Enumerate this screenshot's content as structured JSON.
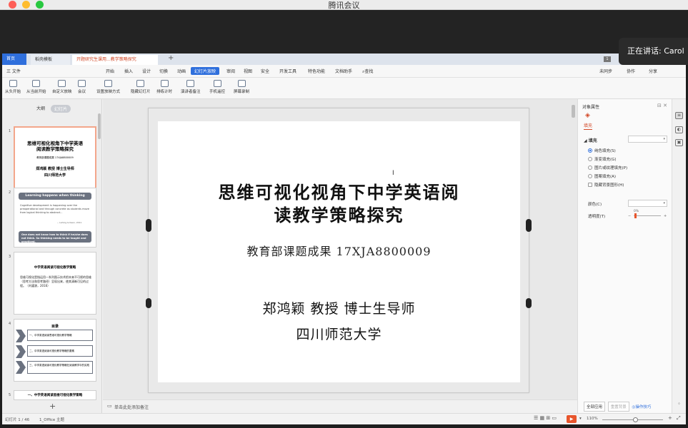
{
  "window": {
    "title": "腾讯会议"
  },
  "meeting": {
    "speaking": "正在讲话: Carol"
  },
  "tabs": {
    "home": "首页",
    "template": "稻壳模板",
    "document": "开题研究生课用...教学策略探究",
    "add": "+",
    "count": "1"
  },
  "menu": {
    "file": "三 文件",
    "items": [
      "开始",
      "插入",
      "设计",
      "切换",
      "动画",
      "幻灯片放映",
      "审阅",
      "视图",
      "安全",
      "开发工具",
      "特色功能",
      "文档助手"
    ],
    "active_index": 5,
    "search": "查找",
    "sync": "未同步",
    "collab": "协作",
    "share": "分享"
  },
  "toolbar": {
    "items": [
      "从头开始",
      "从当前开始",
      "自定义放映",
      "会议",
      "设置放映方式",
      "隐藏幻灯片",
      "排练计时",
      "演讲者备注",
      "手机遥控",
      "屏幕录制"
    ]
  },
  "thumbs": {
    "tab_outline": "大纲",
    "tab_slides": "幻灯片",
    "slides": [
      {
        "num": "1",
        "title": "思维可视化视角下中学英语阅读教学策略探究",
        "sub": "教育部课题成果 17XJA8800009",
        "author": "郑鸿颖 教授 博士生导师",
        "school": "四川师范大学"
      },
      {
        "num": "2",
        "banner": "Learning happens when thinking involved",
        "text": "Cognitive development is happening over the preoperational and through concrete as students move from logical thinking to abstract...",
        "cite": "-- Lehnig & Keen, 2011",
        "note": "One does not know how to think if he/she does not think. So thinking needs to be taught and practiced."
      },
      {
        "num": "3",
        "title": "中学英语阅读可视化教学策略",
        "text": "思维可视化是指运用一系列图示技术把本来不可视的思维（思考方法和思考路径）呈现出来，使其清晰可见的过程。（刘濯源，2016）"
      },
      {
        "num": "4",
        "title": "目录",
        "items": [
          "一、中学英语阅读思维可视化教学策略",
          "二、中学英语阅读可视化教学策略的要素",
          "三、中学英语阅读可视化教学策略在阅读教学中的实践"
        ]
      },
      {
        "num": "5",
        "title": "一、中学英语阅读思维可视化教学策略"
      }
    ]
  },
  "slide": {
    "title_line1": "思维可视化视角下中学英语阅",
    "title_line2": "读教学策略探究",
    "subtitle": "教育部课题成果 17XJA8800009",
    "author": "郑鸿颖 教授 博士生导师",
    "school": "四川师范大学"
  },
  "notes": {
    "placeholder": "单击此处添加备注"
  },
  "props": {
    "title": "对象属性",
    "tab": "填充",
    "section": "填充",
    "options": [
      "纯色填充(S)",
      "渐变填充(G)",
      "图片或纹理填充(P)",
      "图案填充(A)"
    ],
    "selected_index": 0,
    "hide_bg": "隐藏背景图形(H)",
    "color_label": "颜色(C)",
    "transparency_label": "透明度(T)",
    "transparency_value": "0%",
    "apply_all": "全部应用",
    "reset": "重置背景",
    "tips": "操作技巧"
  },
  "status": {
    "slide_info": "幻灯片 1 / 46",
    "theme": "1_Office 主题",
    "zoom": "110%",
    "zoom_level": 0.55
  }
}
